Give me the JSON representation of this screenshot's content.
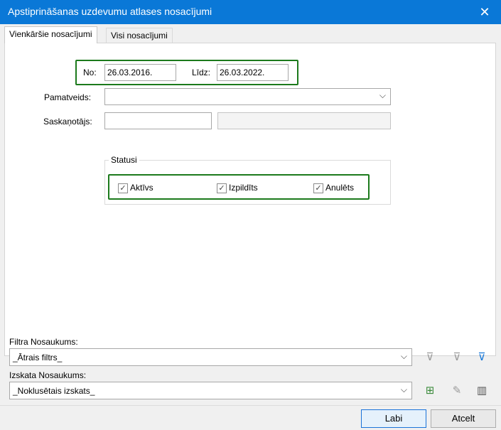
{
  "window": {
    "title": "Apstiprināšanas uzdevumu atlases nosacījumi",
    "close_glyph": "✕"
  },
  "tabs": [
    {
      "label": "Vienkāršie nosacījumi",
      "active": true
    },
    {
      "label": "Visi nosacījumi",
      "active": false
    }
  ],
  "form": {
    "no_label": "No:",
    "no_value": "26.03.2016.",
    "lidz_label": "Līdz:",
    "lidz_value": "26.03.2022.",
    "pamatveids_label": "Pamatveids:",
    "pamatveids_value": "",
    "saskanotajs_label": "Saskaņotājs:",
    "saskanotajs_value": "",
    "saskanotajs_name": ""
  },
  "statusi": {
    "legend": "Statusi",
    "items": [
      {
        "label": "Aktīvs",
        "checked": true
      },
      {
        "label": "Izpildīts",
        "checked": true
      },
      {
        "label": "Anulēts",
        "checked": true
      }
    ]
  },
  "filter": {
    "label": "Filtra Nosaukums:",
    "value": "_Ātrais filtrs_"
  },
  "view": {
    "label": "Izskata Nosaukums:",
    "value": "_Noklusētais izskats_"
  },
  "buttons": {
    "ok": "Labi",
    "cancel": "Atcelt"
  },
  "icons": {
    "chevron": "⌵",
    "check": "✓",
    "filter_remove": "⊽",
    "filter_edit": "⊽",
    "filter_apply": "⊽",
    "view_add": "⊞",
    "view_edit": "✎",
    "view_columns": "▥"
  },
  "colors": {
    "titlebar": "#0a78d7",
    "highlight": "#1c7a1c",
    "filter_active": "#1878d8"
  }
}
